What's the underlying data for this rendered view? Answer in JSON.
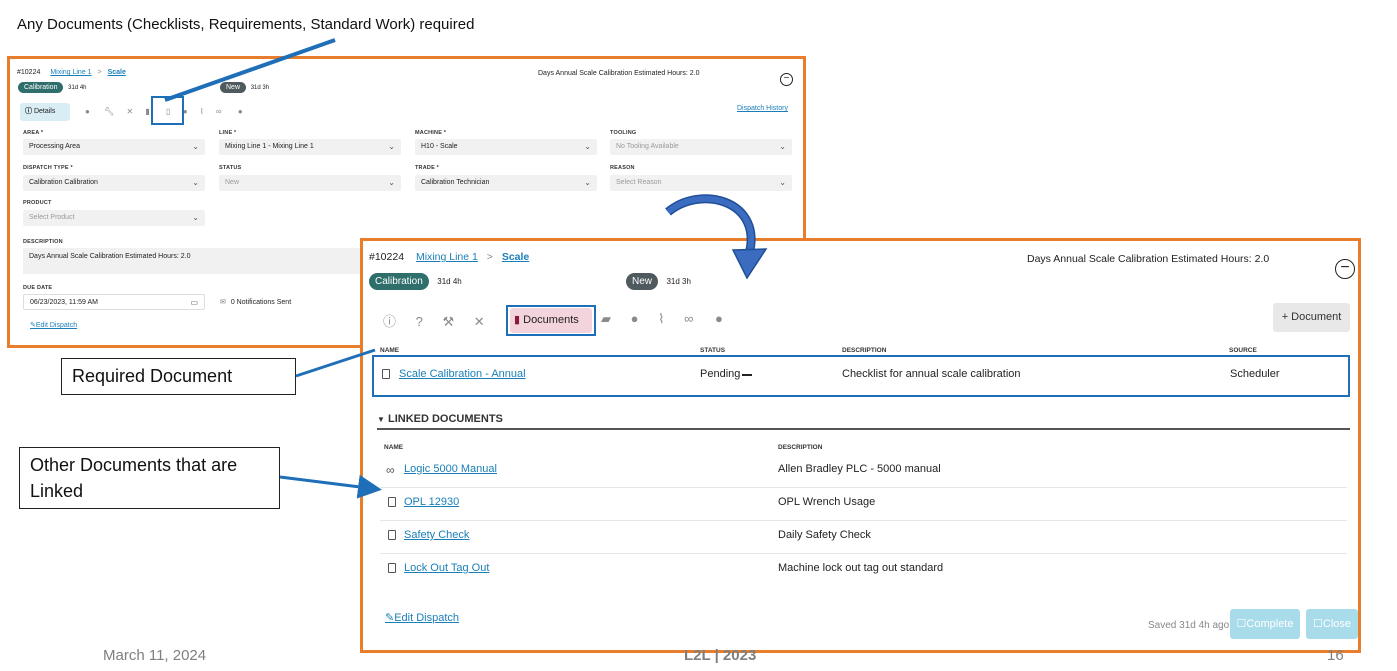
{
  "annotations": {
    "top_caption": "Any Documents (Checklists, Requirements, Standard Work) required",
    "required_document": "Required Document",
    "other_documents": "Other Documents that are Linked"
  },
  "small_panel": {
    "id": "#10224",
    "breadcrumb_line": "Mixing Line 1",
    "breadcrumb_sep": ">",
    "breadcrumb_machine": "Scale",
    "header_title": "Days Annual Scale Calibration Estimated Hours: 2.0",
    "badge_type": "Calibration",
    "badge_type_age": "31d 4h",
    "badge_status": "New",
    "badge_status_age": "31d 3h",
    "details_tab": "Details",
    "dispatch_history": "Dispatch History",
    "area_label": "AREA *",
    "area_value": "Processing Area",
    "line_label": "LINE *",
    "line_value": "Mixing Line 1 - Mixing Line 1",
    "machine_label": "MACHINE *",
    "machine_value": "H10 - Scale",
    "tooling_label": "TOOLING",
    "tooling_value": "No Tooling Available",
    "dispatch_type_label": "DISPATCH TYPE *",
    "dispatch_type_value": "Calibration Calibration",
    "status_label": "STATUS",
    "status_value": "New",
    "trade_label": "TRADE *",
    "trade_value": "Calibration Technician",
    "reason_label": "REASON",
    "reason_value": "Select Reason",
    "product_label": "PRODUCT",
    "product_value": "Select Product",
    "description_label": "DESCRIPTION",
    "description_value": "Days Annual Scale Calibration  Estimated Hours: 2.0",
    "due_date_label": "DUE DATE",
    "due_date_value": "06/23/2023, 11:59 AM",
    "notifications": "0 Notifications Sent",
    "edit_dispatch": "Edit Dispatch"
  },
  "main_panel": {
    "id": "#10224",
    "breadcrumb_line": "Mixing Line 1",
    "breadcrumb_sep": ">",
    "breadcrumb_machine": "Scale",
    "header_title": "Days Annual Scale Calibration Estimated Hours: 2.0",
    "badge_type": "Calibration",
    "badge_type_age": "31d 4h",
    "badge_status": "New",
    "badge_status_age": "31d 3h",
    "documents_tab": "Documents",
    "add_document_button": "+ Document",
    "required_headers": {
      "name": "NAME",
      "status": "STATUS",
      "description": "DESCRIPTION",
      "source": "SOURCE"
    },
    "required_rows": [
      {
        "name": "Scale Calibration - Annual",
        "status": "Pending",
        "description": "Checklist for annual scale calibration",
        "source": "Scheduler"
      }
    ],
    "linked_section_title": "LINKED DOCUMENTS",
    "linked_headers": {
      "name": "NAME",
      "description": "DESCRIPTION"
    },
    "linked_rows": [
      {
        "icon": "link-icon",
        "name": "Logic 5000 Manual",
        "description": "Allen Bradley PLC - 5000 manual"
      },
      {
        "icon": "file-icon",
        "name": "OPL 12930",
        "description": "OPL Wrench Usage"
      },
      {
        "icon": "checklist-icon",
        "name": "Safety Check",
        "description": "Daily Safety Check"
      },
      {
        "icon": "file-icon",
        "name": "Lock Out Tag Out",
        "description": "Machine lock out tag out standard"
      }
    ],
    "edit_dispatch": "Edit Dispatch",
    "saved_text": "Saved 31d 4h ago",
    "complete_button": "Complete",
    "close_button": "Close"
  },
  "footer": {
    "date": "March 11, 2024",
    "brand": "L2L | 2023",
    "page_number": "16"
  },
  "colors": {
    "orange_frame": "#e87d2b",
    "teal_badge": "#2e6e6b",
    "gray_badge": "#4f5a5e",
    "link_blue": "#1a7fb8",
    "arrow_blue": "#1f6fb8",
    "documents_tab_bg": "#f4d4dc"
  }
}
